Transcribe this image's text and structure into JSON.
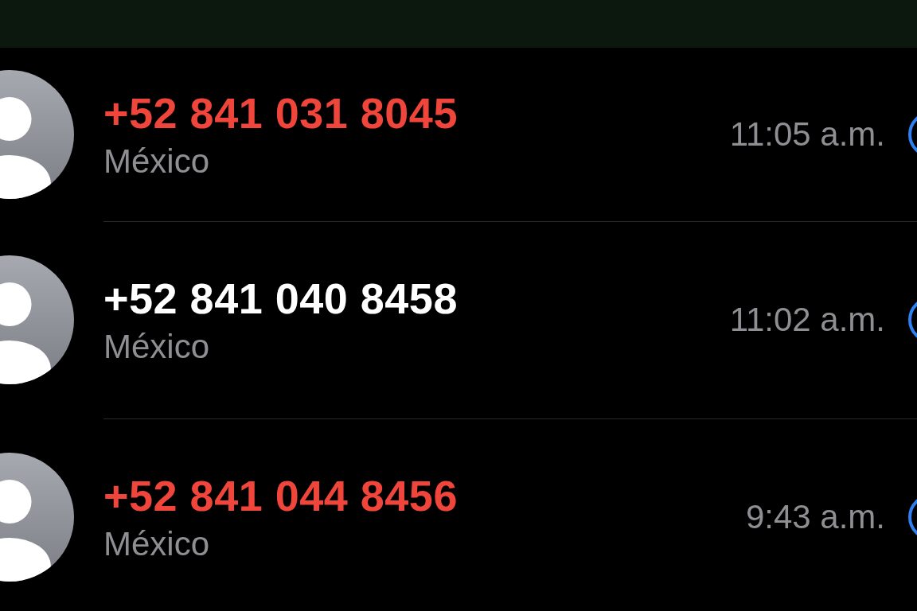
{
  "calls": [
    {
      "number": "+52 841 031 8045",
      "location": "México",
      "time": "11:05 a.m.",
      "missed": true
    },
    {
      "number": "+52 841 040 8458",
      "location": "México",
      "time": "11:02 a.m.",
      "missed": false
    },
    {
      "number": "+52 841 044 8456",
      "location": "México",
      "time": "9:43 a.m.",
      "missed": true
    }
  ]
}
